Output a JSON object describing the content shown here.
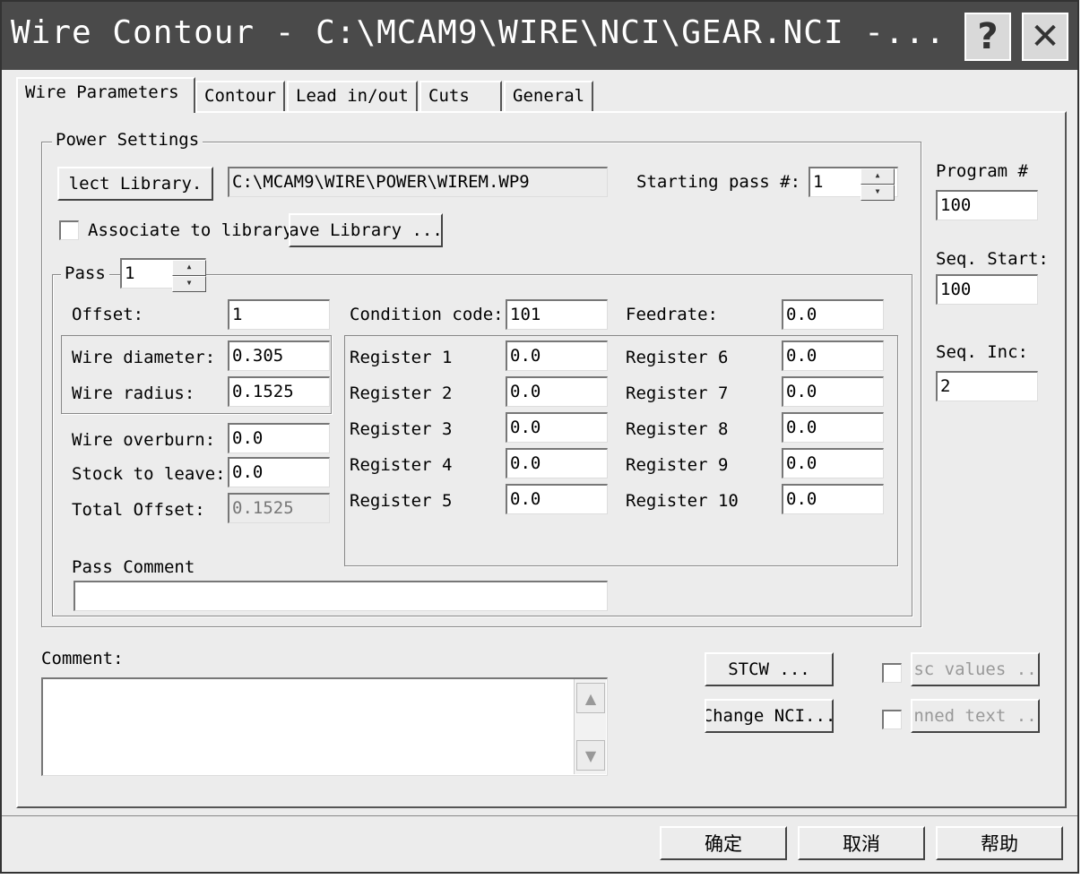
{
  "window": {
    "title": "Wire Contour - C:\\MCAM9\\WIRE\\NCI\\GEAR.NCI -...",
    "help_glyph": "?",
    "close_glyph": "✕"
  },
  "tabs": [
    {
      "label": "Wire Parameters"
    },
    {
      "label": "Contour"
    },
    {
      "label": "Lead in/out"
    },
    {
      "label": "Cuts"
    },
    {
      "label": "General"
    }
  ],
  "power": {
    "title": "Power Settings",
    "select_library": "lect Library.",
    "library_path": "C:\\MCAM9\\WIRE\\POWER\\WIREM.WP9",
    "starting_pass_label": "Starting pass #:",
    "starting_pass_value": "1",
    "associate_label": "Associate to library",
    "associate_checked": false,
    "save_library": "ave Library ..."
  },
  "pass": {
    "label": "Pass",
    "value": "1",
    "offset_label": "Offset:",
    "offset_value": "1",
    "wire_diameter_label": "Wire diameter:",
    "wire_diameter_value": "0.305",
    "wire_radius_label": "Wire radius:",
    "wire_radius_value": "0.1525",
    "wire_overburn_label": "Wire overburn:",
    "wire_overburn_value": "0.0",
    "stock_label": "Stock to leave:",
    "stock_value": "0.0",
    "total_offset_label": "Total Offset:",
    "total_offset_value": "0.1525",
    "condition_label": "Condition code:",
    "condition_value": "101",
    "feedrate_label": "Feedrate:",
    "feedrate_value": "0.0",
    "pass_comment_label": "Pass Comment",
    "pass_comment_value": ""
  },
  "registers": [
    {
      "label": "Register 1",
      "value": "0.0"
    },
    {
      "label": "Register 2",
      "value": "0.0"
    },
    {
      "label": "Register 3",
      "value": "0.0"
    },
    {
      "label": "Register 4",
      "value": "0.0"
    },
    {
      "label": "Register 5",
      "value": "0.0"
    },
    {
      "label": "Register 6",
      "value": "0.0"
    },
    {
      "label": "Register 7",
      "value": "0.0"
    },
    {
      "label": "Register 8",
      "value": "0.0"
    },
    {
      "label": "Register 9",
      "value": "0.0"
    },
    {
      "label": "Register 10",
      "value": "0.0"
    }
  ],
  "program": {
    "program_label": "Program #",
    "program_value": "100",
    "seq_start_label": "Seq. Start:",
    "seq_start_value": "100",
    "seq_inc_label": "Seq. Inc:",
    "seq_inc_value": "2"
  },
  "comment": {
    "label": "Comment:",
    "value": ""
  },
  "actions": {
    "stcw": "STCW ...",
    "change_nci": "Change NCI...",
    "misc_values": "isc values ...",
    "canned_text": "anned text ...",
    "misc_checked": false,
    "canned_checked": false
  },
  "footer": {
    "ok": "确定",
    "cancel": "取消",
    "help": "帮助"
  }
}
